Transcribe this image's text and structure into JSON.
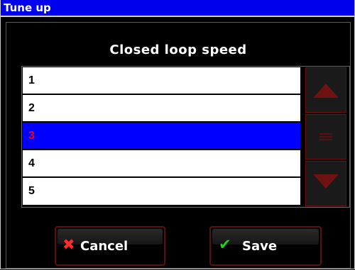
{
  "window": {
    "title": "Tune up"
  },
  "heading": "Closed loop speed",
  "list": {
    "items": [
      {
        "label": "1",
        "selected": false
      },
      {
        "label": "2",
        "selected": false
      },
      {
        "label": "3",
        "selected": true
      },
      {
        "label": "4",
        "selected": false
      },
      {
        "label": "5",
        "selected": false
      }
    ]
  },
  "buttons": {
    "cancel_label": "Cancel",
    "save_label": "Save"
  },
  "icons": {
    "cancel": "x-icon",
    "save": "checkmark-icon",
    "scroll_up": "triangle-up-icon",
    "scroll_thumb": "grip-lines-icon",
    "scroll_down": "triangle-down-icon"
  },
  "colors": {
    "titlebar": "#0000ee",
    "selection_bg": "#0000ff",
    "selection_text": "#ff0000",
    "cancel_icon": "#ff2a2a",
    "save_icon": "#22cc22",
    "accent_dark_red": "#6e1212"
  }
}
